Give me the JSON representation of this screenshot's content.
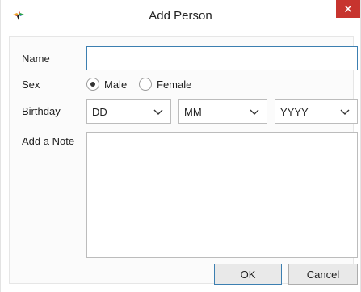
{
  "window": {
    "title": "Add Person",
    "close_glyph": "✕",
    "app_icon": "star-logo-icon"
  },
  "form": {
    "name_label": "Name",
    "name_value": "",
    "sex_label": "Sex",
    "sex_options": [
      {
        "label": "Male",
        "selected": true
      },
      {
        "label": "Female",
        "selected": false
      }
    ],
    "birthday_label": "Birthday",
    "birthday_day": "DD",
    "birthday_month": "MM",
    "birthday_year": "YYYY",
    "note_label": "Add a Note",
    "note_value": ""
  },
  "buttons": {
    "ok": "OK",
    "cancel": "Cancel"
  },
  "colors": {
    "close_bg": "#c7342e",
    "focus_border": "#3c7fb1"
  }
}
